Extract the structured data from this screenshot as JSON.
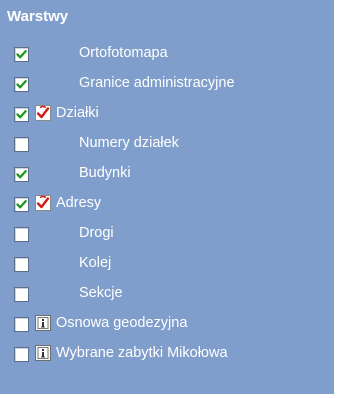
{
  "panel": {
    "title": "Warstwy",
    "background": "#7f9ecb"
  },
  "layers": [
    {
      "label": "Ortofotomapa",
      "checked": true,
      "icon": "none"
    },
    {
      "label": "Granice administracyjne",
      "checked": true,
      "icon": "none"
    },
    {
      "label": "Działki",
      "checked": true,
      "icon": "query-check-icon"
    },
    {
      "label": "Numery działek",
      "checked": false,
      "icon": "none"
    },
    {
      "label": "Budynki",
      "checked": true,
      "icon": "none"
    },
    {
      "label": "Adresy",
      "checked": true,
      "icon": "query-check-icon"
    },
    {
      "label": "Drogi",
      "checked": false,
      "icon": "none"
    },
    {
      "label": "Kolej",
      "checked": false,
      "icon": "none"
    },
    {
      "label": "Sekcje",
      "checked": false,
      "icon": "none"
    },
    {
      "label": "Osnowa geodezyjna",
      "checked": false,
      "icon": "info-icon"
    },
    {
      "label": "Wybrane zabytki Mikołowa",
      "checked": false,
      "icon": "info-icon"
    }
  ],
  "colors": {
    "checkmark": "#1a9a1a",
    "query_icon": "#d21a1a"
  }
}
